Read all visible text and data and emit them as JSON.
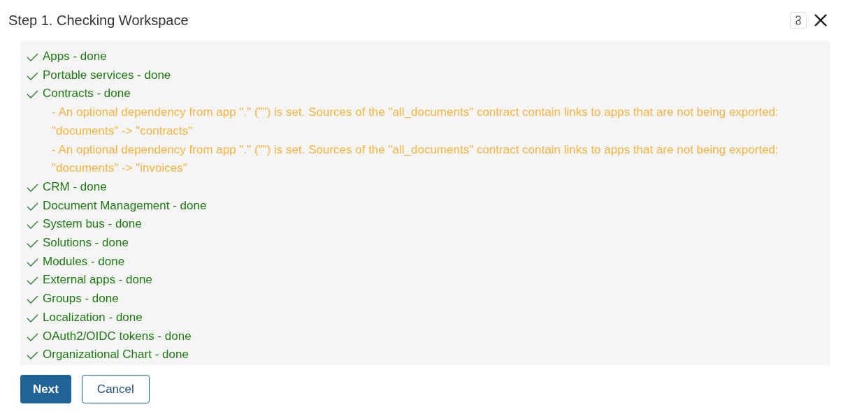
{
  "title": "Step 1. Checking Workspace",
  "items": [
    {
      "label": "Apps - done",
      "kind": "done"
    },
    {
      "label": "Portable services - done",
      "kind": "done"
    },
    {
      "label": "Contracts - done",
      "kind": "done",
      "children": [
        {
          "label": "- An optional dependency from app \".\" (\"\") is set. Sources of the \"all_documents\" contract contain links to apps that are not being exported: \"documents\" -> \"contracts\"",
          "kind": "warning"
        },
        {
          "label": "- An optional dependency from app \".\" (\"\") is set. Sources of the \"all_documents\" contract contain links to apps that are not being exported: \"documents\" -> \"invoices\"",
          "kind": "warning"
        }
      ]
    },
    {
      "label": "CRM - done",
      "kind": "done"
    },
    {
      "label": "Document Management - done",
      "kind": "done"
    },
    {
      "label": "System bus - done",
      "kind": "done"
    },
    {
      "label": "Solutions - done",
      "kind": "done"
    },
    {
      "label": "Modules - done",
      "kind": "done"
    },
    {
      "label": "External apps - done",
      "kind": "done"
    },
    {
      "label": "Groups - done",
      "kind": "done"
    },
    {
      "label": "Localization - done",
      "kind": "done"
    },
    {
      "label": "OAuth2/OIDC tokens - done",
      "kind": "done"
    },
    {
      "label": "Organizational Chart - done",
      "kind": "done"
    }
  ],
  "buttons": [
    {
      "label": "Next",
      "kind": "primary"
    },
    {
      "label": "Cancel",
      "kind": "secondary"
    }
  ]
}
